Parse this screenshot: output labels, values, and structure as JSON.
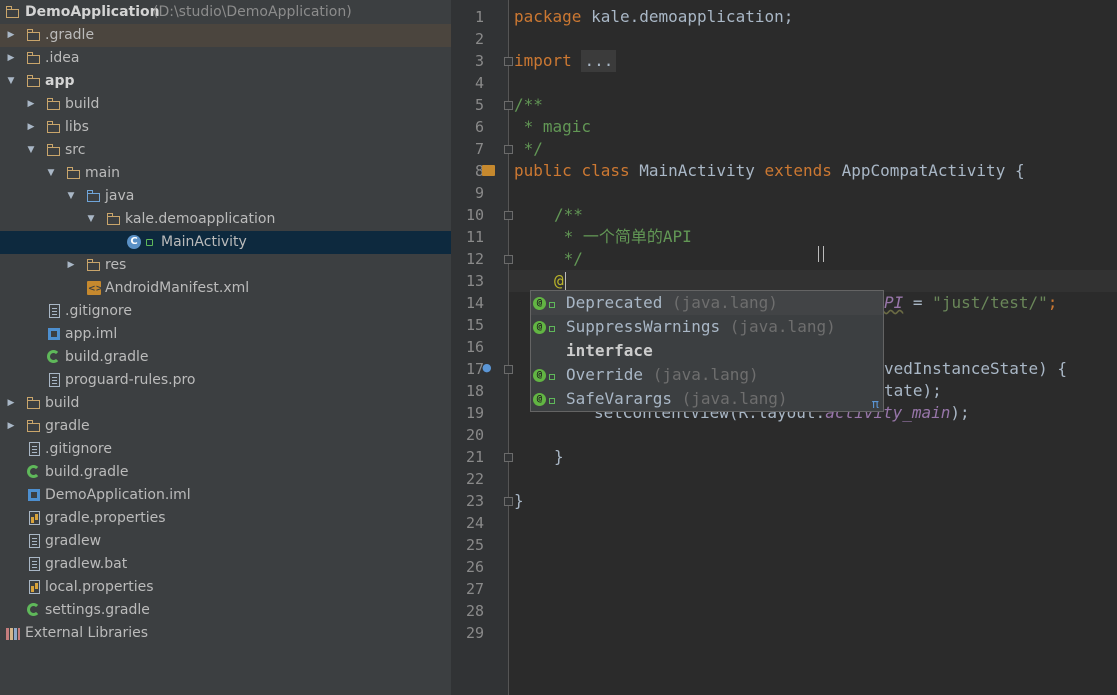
{
  "tree": {
    "rows": [
      {
        "label": "DemoApplication",
        "path": "(D:\\studio\\DemoApplication)",
        "icon": "module-folder-icon"
      },
      {
        "label": ".gradle",
        "icon": "folder-icon"
      },
      {
        "label": ".idea",
        "icon": "folder-icon"
      },
      {
        "label": "app",
        "icon": "module-folder-icon"
      },
      {
        "label": "build",
        "icon": "folder-icon"
      },
      {
        "label": "libs",
        "icon": "folder-icon"
      },
      {
        "label": "src",
        "icon": "folder-icon"
      },
      {
        "label": "main",
        "icon": "folder-icon"
      },
      {
        "label": "java",
        "icon": "source-folder-icon"
      },
      {
        "label": "kale.demoapplication",
        "icon": "package-icon"
      },
      {
        "label": "MainActivity",
        "icon": "class-icon",
        "icon_letter": "C"
      },
      {
        "label": "res",
        "icon": "resource-folder-icon"
      },
      {
        "label": "AndroidManifest.xml",
        "icon": "xml-file-icon"
      },
      {
        "label": ".gitignore",
        "icon": "text-file-icon"
      },
      {
        "label": "app.iml",
        "icon": "iml-file-icon"
      },
      {
        "label": "build.gradle",
        "icon": "gradle-file-icon"
      },
      {
        "label": "proguard-rules.pro",
        "icon": "text-file-icon"
      },
      {
        "label": "build",
        "icon": "folder-icon"
      },
      {
        "label": "gradle",
        "icon": "folder-icon"
      },
      {
        "label": ".gitignore",
        "icon": "text-file-icon"
      },
      {
        "label": "build.gradle",
        "icon": "gradle-file-icon"
      },
      {
        "label": "DemoApplication.iml",
        "icon": "iml-file-icon"
      },
      {
        "label": "gradle.properties",
        "icon": "properties-file-icon"
      },
      {
        "label": "gradlew",
        "icon": "text-file-icon"
      },
      {
        "label": "gradlew.bat",
        "icon": "text-file-icon"
      },
      {
        "label": "local.properties",
        "icon": "properties-file-icon"
      },
      {
        "label": "settings.gradle",
        "icon": "gradle-file-icon"
      },
      {
        "label": "External Libraries",
        "icon": "libraries-icon"
      }
    ]
  },
  "editor": {
    "line_numbers": [
      "1",
      "2",
      "3",
      "4",
      "5",
      "6",
      "7",
      "8",
      "9",
      "10",
      "11",
      "12",
      "13",
      "14",
      "15",
      "16",
      "17",
      "18",
      "19",
      "20",
      "21",
      "22",
      "23",
      "24",
      "25",
      "26",
      "27",
      "28",
      "29"
    ],
    "code": {
      "l1_kw": "package",
      "l1_rest": " kale.demoapplication;",
      "l3_kw": "import",
      "l3_fold": "...",
      "l6": "/**",
      "l7": " * magic",
      "l8": " */",
      "l9_kw1": "public",
      "l9_kw2": "class",
      "l9_name": "MainActivity",
      "l9_kw3": "extends",
      "l9_super": "AppCompatActivity {",
      "l11": "/**",
      "l12": " * 一个简单的API",
      "l13": " */",
      "l14": "@",
      "l15_field": "PI",
      "l15_eq": " = ",
      "l15_str": "\"just/test/\"",
      "l15_end": ";",
      "l18_tail": "vedInstanceState) {",
      "l19_tail": "tate);",
      "l20_pre": "setContentView(R.layout.",
      "l20_field": "activity_main",
      "l20_end": ");",
      "l22": "}",
      "l24": "}"
    }
  },
  "completion": {
    "items": [
      {
        "name": "Deprecated",
        "pkg": " (java.lang)",
        "icon": "annotation-icon",
        "icon_letter": "@"
      },
      {
        "name": "SuppressWarnings",
        "pkg": " (java.lang)",
        "icon": "annotation-icon",
        "icon_letter": "@"
      },
      {
        "name": "interface",
        "pkg": "",
        "icon": "none"
      },
      {
        "name": "Override",
        "pkg": " (java.lang)",
        "icon": "annotation-icon",
        "icon_letter": "@"
      },
      {
        "name": "SafeVarargs",
        "pkg": " (java.lang)",
        "icon": "annotation-icon",
        "icon_letter": "@"
      }
    ],
    "pi_symbol": "π"
  },
  "colors": {
    "keyword": "#cc7832",
    "comment": "#629755",
    "string": "#6a8759",
    "annotation": "#bbb529",
    "field": "#9876aa",
    "tree_background": "#3c3f41",
    "editor_background": "#2b2b2b",
    "selection": "#0d293e"
  }
}
